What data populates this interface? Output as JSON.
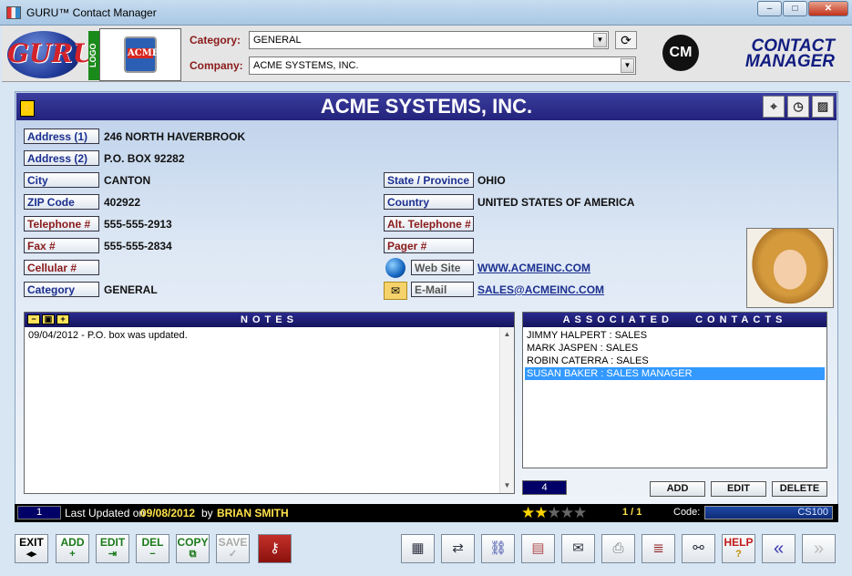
{
  "window": {
    "title": "GURU™ Contact Manager",
    "min": "‒",
    "max": "□",
    "close": "✕"
  },
  "header": {
    "guru_logo_text": "GURU",
    "logo_tab": "LOGO",
    "company_logo_text": "ACME",
    "category_label": "Category:",
    "category_value": "GENERAL",
    "company_label": "Company:",
    "company_value": "ACME SYSTEMS, INC.",
    "cm_badge": "CM",
    "cm_line1": "CONTACT",
    "cm_line2": "MANAGER"
  },
  "company": {
    "name": "ACME SYSTEMS, INC.",
    "fields": {
      "address1": {
        "label": "Address (1)",
        "value": "246 NORTH HAVERBROOK"
      },
      "address2": {
        "label": "Address (2)",
        "value": "P.O. BOX 92282"
      },
      "city": {
        "label": "City",
        "value": "CANTON"
      },
      "zip": {
        "label": "ZIP Code",
        "value": "402922"
      },
      "telephone": {
        "label": "Telephone #",
        "value": "555-555-2913"
      },
      "fax": {
        "label": "Fax #",
        "value": "555-555-2834"
      },
      "cellular": {
        "label": "Cellular #",
        "value": ""
      },
      "category": {
        "label": "Category",
        "value": "GENERAL"
      },
      "state": {
        "label": "State / Province",
        "value": "OHIO"
      },
      "country": {
        "label": "Country",
        "value": "UNITED STATES OF AMERICA"
      },
      "alt_telephone": {
        "label": "Alt. Telephone #",
        "value": ""
      },
      "pager": {
        "label": "Pager #",
        "value": ""
      },
      "website": {
        "label": "Web Site",
        "value": "WWW.ACMEINC.COM"
      },
      "email": {
        "label": "E-Mail",
        "value": "SALES@ACMEINC.COM"
      }
    }
  },
  "notes": {
    "title": "NOTES",
    "text": "09/04/2012 - P.O. box was updated."
  },
  "associated": {
    "title": "ASSOCIATED   CONTACTS",
    "contacts": [
      "JIMMY HALPERT : SALES",
      "MARK JASPEN : SALES",
      "ROBIN CATERRA : SALES",
      "SUSAN BAKER : SALES MANAGER"
    ],
    "selected_index": 3,
    "count": "4",
    "add": "ADD",
    "edit": "EDIT",
    "delete": "DELETE"
  },
  "status": {
    "record": "1",
    "last_updated_label": "Last Updated on",
    "date": "09/08/2012",
    "by": "by",
    "user": "BRIAN SMITH",
    "rating": 2,
    "rating_max": 5,
    "position": "1 / 1",
    "code_label": "Code:",
    "code": "CS100"
  },
  "toolbar": {
    "exit": "EXIT",
    "add": "ADD",
    "edit": "EDIT",
    "del": "DEL",
    "copy": "COPY",
    "save": "SAVE",
    "help": "HELP"
  }
}
